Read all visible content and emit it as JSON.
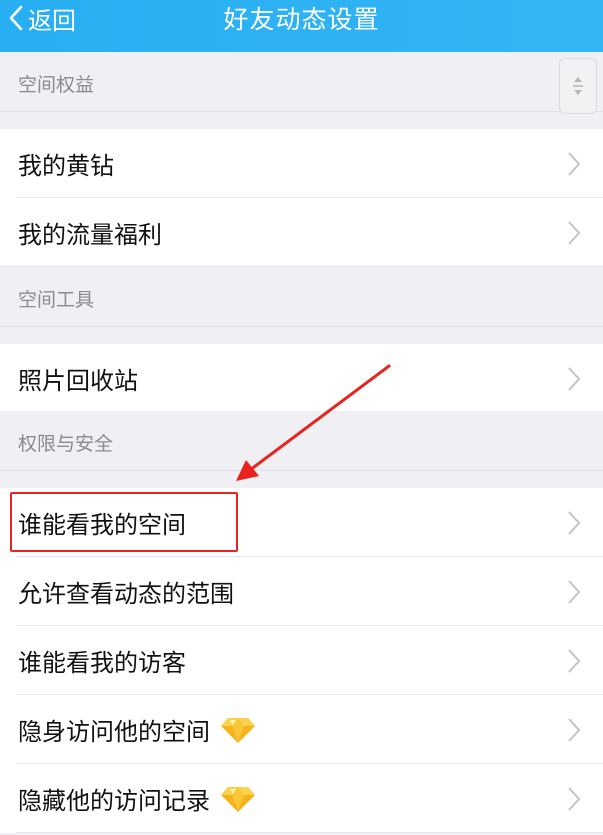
{
  "header": {
    "back_label": "返回",
    "title": "好友动态设置",
    "background": "#2ab0f4"
  },
  "sections": [
    {
      "title": "空间权益",
      "items": [
        {
          "label": "我的黄钻"
        },
        {
          "label": "我的流量福利"
        }
      ]
    },
    {
      "title": "空间工具",
      "items": [
        {
          "label": "照片回收站"
        }
      ]
    },
    {
      "title": "权限与安全",
      "items": [
        {
          "label": "谁能看我的空间"
        },
        {
          "label": "允许查看动态的范围"
        },
        {
          "label": "谁能看我的访客"
        },
        {
          "label": "隐身访问他的空间",
          "badge_icon": "vip-diamond-icon"
        },
        {
          "label": "隐藏他的访问记录",
          "badge_icon": "vip-diamond-icon"
        }
      ]
    }
  ],
  "annotation": {
    "highlighted_item": "谁能看我的空间",
    "color": "#e8231f"
  },
  "icons": {
    "back": "chevron-left-icon",
    "row": "chevron-right-icon",
    "scroll": "scroll-handle-icon"
  }
}
